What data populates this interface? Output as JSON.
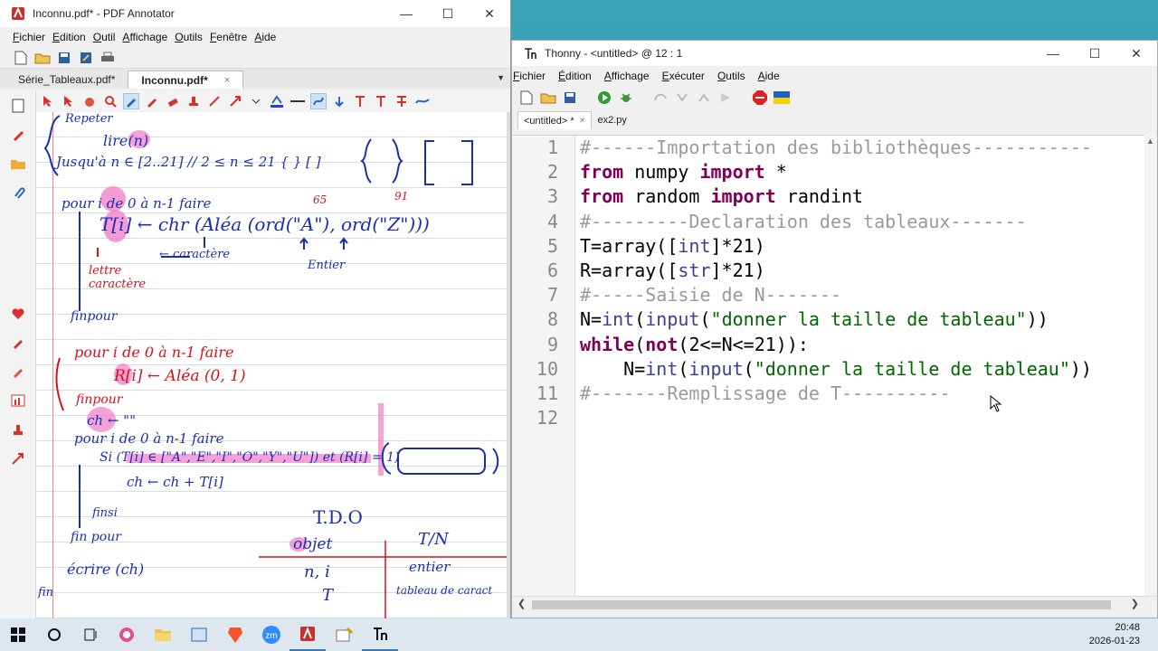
{
  "pdf_window": {
    "title": "Inconnu.pdf* - PDF Annotator",
    "menu": [
      "Fichier",
      "Edition",
      "Outil",
      "Affichage",
      "Outils",
      "Fenêtre",
      "Aide"
    ],
    "tabs": [
      {
        "label": "Série_Tableaux.pdf*",
        "active": false
      },
      {
        "label": "Inconnu.pdf*",
        "active": true
      }
    ],
    "tab_close": "×",
    "notes": {
      "line1": "Repeter",
      "line2": "lire(n)",
      "line3": "Jusqu'à n ∈ [2..21]   //   2 ≤ n ≤ 21   { }   [ ]",
      "line4": "pour i de 0 à n-1 faire",
      "line4b": "65",
      "line4c": "91",
      "line5": "T[i] ← chr (Aléa (ord(\"A\"), ord(\"Z\")))",
      "line6": "← caractère",
      "line6b": "Entier",
      "line7": "lettre caractère",
      "line8": "finpour",
      "line9": "pour i de 0 à n-1 faire",
      "line10": "R[i] ← Aléa (0, 1)",
      "line11": "finpour",
      "line12": "ch ← \"\"",
      "line13": "pour i de 0 à n-1 faire",
      "line14": "Si (T[i] ∈ [\"A\",\"E\",\"I\",\"O\",\"Y\",\"U\"]) et (R[i] = 1)",
      "line15": "ch ← ch + T[i]",
      "line16": "finsi",
      "line17": "fin pour",
      "line18": "écrire (ch)",
      "line19": "fin",
      "tdo_title": "T.D.O",
      "tdo_col1": "objet",
      "tdo_col2": "T/N",
      "tdo_row1a": "n, i",
      "tdo_row1b": "entier",
      "tdo_row2a": "T",
      "tdo_row2b": "tableau de caract"
    }
  },
  "thonny": {
    "title": "Thonny  -  <untitled>  @  12 : 1",
    "menu": [
      "Fichier",
      "Édition",
      "Affichage",
      "Exécuter",
      "Outils",
      "Aide"
    ],
    "tabs": [
      {
        "label": "<untitled> *",
        "active": true
      },
      {
        "label": "ex2.py",
        "active": false
      }
    ],
    "tab_close": "×",
    "line_numbers": [
      "1",
      "2",
      "3",
      "4",
      "5",
      "6",
      "7",
      "8",
      "9",
      "10",
      "11",
      "12"
    ],
    "code": [
      [
        {
          "t": "#------Importation des bibliothèques-----------",
          "c": "cm"
        }
      ],
      [
        {
          "t": "from",
          "c": "kw"
        },
        {
          "t": " numpy ",
          "c": ""
        },
        {
          "t": "import",
          "c": "kw"
        },
        {
          "t": " *",
          "c": ""
        }
      ],
      [
        {
          "t": "from",
          "c": "kw"
        },
        {
          "t": " random ",
          "c": ""
        },
        {
          "t": "import",
          "c": "kw"
        },
        {
          "t": " randint",
          "c": ""
        }
      ],
      [
        {
          "t": "#---------Declaration des tableaux-------",
          "c": "cm"
        }
      ],
      [
        {
          "t": "T=array([",
          "c": ""
        },
        {
          "t": "int",
          "c": "bi"
        },
        {
          "t": "]*",
          "c": ""
        },
        {
          "t": "21",
          "c": "num"
        },
        {
          "t": ")",
          "c": ""
        }
      ],
      [
        {
          "t": "R=array([",
          "c": ""
        },
        {
          "t": "str",
          "c": "bi"
        },
        {
          "t": "]*",
          "c": ""
        },
        {
          "t": "21",
          "c": "num"
        },
        {
          "t": ")",
          "c": ""
        }
      ],
      [
        {
          "t": "#-----Saisie de N-------",
          "c": "cm"
        }
      ],
      [
        {
          "t": "N=",
          "c": ""
        },
        {
          "t": "int",
          "c": "bi"
        },
        {
          "t": "(",
          "c": ""
        },
        {
          "t": "input",
          "c": "bi"
        },
        {
          "t": "(",
          "c": ""
        },
        {
          "t": "\"donner la taille de tableau\"",
          "c": "str"
        },
        {
          "t": "))",
          "c": ""
        }
      ],
      [
        {
          "t": "while",
          "c": "kw"
        },
        {
          "t": "(",
          "c": ""
        },
        {
          "t": "not",
          "c": "kw"
        },
        {
          "t": "(",
          "c": ""
        },
        {
          "t": "2",
          "c": "num"
        },
        {
          "t": "<=N<=",
          "c": ""
        },
        {
          "t": "21",
          "c": "num"
        },
        {
          "t": ")):",
          "c": ""
        }
      ],
      [
        {
          "t": "    N=",
          "c": ""
        },
        {
          "t": "int",
          "c": "bi"
        },
        {
          "t": "(",
          "c": ""
        },
        {
          "t": "input",
          "c": "bi"
        },
        {
          "t": "(",
          "c": ""
        },
        {
          "t": "\"donner la taille de tableau\"",
          "c": "str"
        },
        {
          "t": "))",
          "c": ""
        }
      ],
      [
        {
          "t": "#-------Remplissage de T----------",
          "c": "cm"
        }
      ],
      [
        {
          "t": "",
          "c": ""
        }
      ]
    ]
  },
  "clock": {
    "time": "20:48",
    "date": "2026-01-23"
  },
  "colors": {
    "accent": "#3b78c5",
    "keyword": "#7f0055",
    "comment": "#9a9a9a",
    "string": "#006600",
    "ink_blue": "#1a2fb0",
    "ink_red": "#d8101a",
    "highlight_pink": "#f07ac8"
  }
}
